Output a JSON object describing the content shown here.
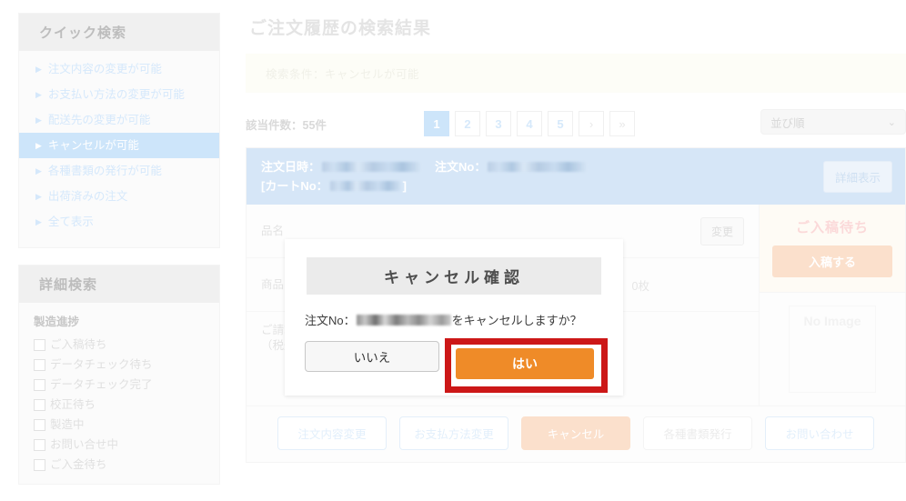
{
  "sidebar": {
    "quick_search": {
      "title": "クイック検索",
      "items": [
        {
          "label": "注文内容の変更が可能",
          "active": false
        },
        {
          "label": "お支払い方法の変更が可能",
          "active": false
        },
        {
          "label": "配送先の変更が可能",
          "active": false
        },
        {
          "label": "キャンセルが可能",
          "active": true
        },
        {
          "label": "各種書類の発行が可能",
          "active": false
        },
        {
          "label": "出荷済みの注文",
          "active": false
        },
        {
          "label": "全て表示",
          "active": false
        }
      ]
    },
    "detail_search": {
      "title": "詳細検索",
      "group_label": "製造進捗",
      "checkboxes": [
        {
          "label": "ご入稿待ち",
          "checked": false
        },
        {
          "label": "データチェック待ち",
          "checked": false
        },
        {
          "label": "データチェック完了",
          "checked": false
        },
        {
          "label": "校正待ち",
          "checked": false
        },
        {
          "label": "製造中",
          "checked": false
        },
        {
          "label": "お問い合せ中",
          "checked": false
        },
        {
          "label": "ご入金待ち",
          "checked": false
        }
      ]
    }
  },
  "main": {
    "page_title": "ご注文履歴の検索結果",
    "search_condition": "検索条件：キャンセルが可能",
    "result_count": "該当件数：55件",
    "pagination": {
      "pages": [
        "1",
        "2",
        "3",
        "4",
        "5"
      ],
      "current": "1",
      "next_label": "›",
      "last_label": "»"
    },
    "sort": {
      "selected": "並び順",
      "chevron": "⌄"
    },
    "order": {
      "date_label": "注文日時：",
      "date_value_redacted": true,
      "order_no_label": "注文No：",
      "order_no_redacted": true,
      "cart_no_label": "[カートNo：",
      "cart_no_suffix": "]",
      "cart_no_redacted": true,
      "detail_button": "詳細表示",
      "rows": [
        {
          "label": "品名",
          "value": "",
          "action": "変更"
        },
        {
          "label": "商品",
          "value": "0枚",
          "action": ""
        },
        {
          "label": "ご請求\n（税込",
          "value": "",
          "action": ""
        }
      ],
      "row_labels": [
        "品名",
        "商品",
        "ご請求",
        "（税込"
      ],
      "quantity_text": "0枚",
      "status": {
        "label": "ご入稿待ち",
        "action_button": "入稿する"
      },
      "thumbnail_placeholder": "No Image",
      "actions": [
        {
          "label": "注文内容変更",
          "style": "link"
        },
        {
          "label": "お支払方法変更",
          "style": "link"
        },
        {
          "label": "キャンセル",
          "style": "primary"
        },
        {
          "label": "各種書類発行",
          "style": "disabled"
        },
        {
          "label": "お問い合わせ",
          "style": "link"
        }
      ]
    }
  },
  "modal": {
    "title": "キャンセル確認",
    "message_prefix": "注文No：",
    "message_suffix": "をキャンセルしますか？",
    "order_no_redacted": true,
    "no_button": "いいえ",
    "yes_button": "はい"
  },
  "colors": {
    "accent_blue": "#cde5fa",
    "header_blue": "#d6e6f7",
    "orange": "#ef8b28",
    "orange_muted": "#fbe0cc",
    "annotation_red": "#cc1717",
    "pink_status": "#fbd9d9"
  }
}
